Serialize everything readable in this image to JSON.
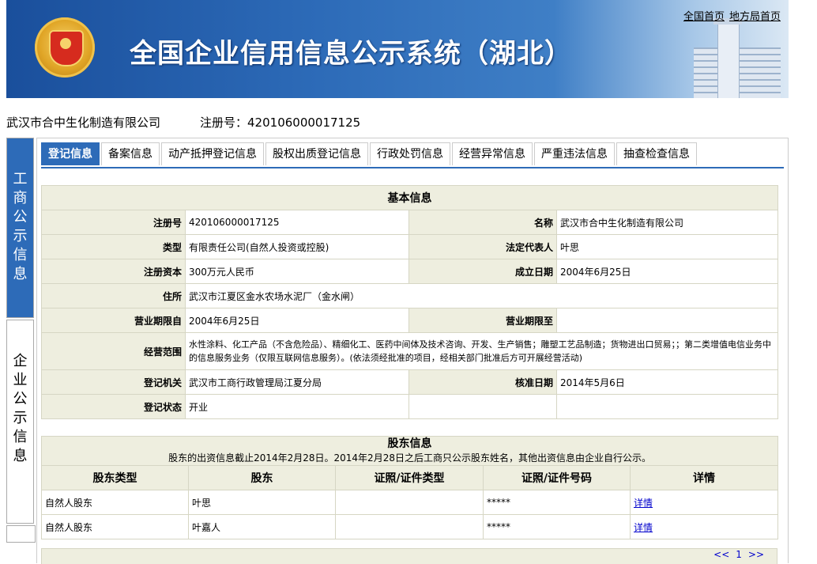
{
  "header": {
    "title": "全国企业信用信息公示系统（湖北）",
    "links": [
      "全国首页",
      "地方局首页"
    ]
  },
  "company": {
    "name": "武汉市合中生化制造有限公司",
    "reg_label": "注册号：420106000017125"
  },
  "leftnav": {
    "items": [
      "工商公示信息",
      "企业公示信息"
    ]
  },
  "tabs": [
    "登记信息",
    "备案信息",
    "动产抵押登记信息",
    "股权出质登记信息",
    "行政处罚信息",
    "经营异常信息",
    "严重违法信息",
    "抽查检查信息"
  ],
  "basic": {
    "caption": "基本信息",
    "labels": {
      "reg_no": "注册号",
      "name": "名称",
      "type": "类型",
      "legal_rep": "法定代表人",
      "capital": "注册资本",
      "founded": "成立日期",
      "address": "住所",
      "term_from": "营业期限自",
      "term_to": "营业期限至",
      "scope": "经营范围",
      "authority": "登记机关",
      "approved": "核准日期",
      "status": "登记状态"
    },
    "values": {
      "reg_no": "420106000017125",
      "name": "武汉市合中生化制造有限公司",
      "type": "有限责任公司(自然人投资或控股)",
      "legal_rep": "叶思",
      "capital": "300万元人民币",
      "founded": "2004年6月25日",
      "address": "武汉市江夏区金水农场水泥厂（金水闸）",
      "term_from": "2004年6月25日",
      "term_to": "",
      "scope": "水性涂料、化工产品（不含危险品）、精细化工、医药中间体及技术咨询、开发、生产销售；雕塑工艺品制造；货物进出口贸易；；第二类增值电信业务中的信息服务业务（仅限互联网信息服务）。(依法须经批准的项目，经相关部门批准后方可开展经营活动)",
      "authority": "武汉市工商行政管理局江夏分局",
      "approved": "2014年5月6日",
      "status": "开业"
    }
  },
  "shareholders": {
    "caption": "股东信息",
    "note": "股东的出资信息截止2014年2月28日。2014年2月28日之后工商只公示股东姓名，其他出资信息由企业自行公示。",
    "columns": [
      "股东类型",
      "股东",
      "证照/证件类型",
      "证照/证件号码",
      "详情"
    ],
    "rows": [
      {
        "type": "自然人股东",
        "name": "叶思",
        "id_type": "",
        "id_no": "*****",
        "detail": "详情"
      },
      {
        "type": "自然人股东",
        "name": "叶嘉人",
        "id_type": "",
        "id_no": "*****",
        "detail": "详情"
      }
    ],
    "pager": {
      "prev": "<<",
      "page": "1",
      "next": ">>"
    }
  }
}
